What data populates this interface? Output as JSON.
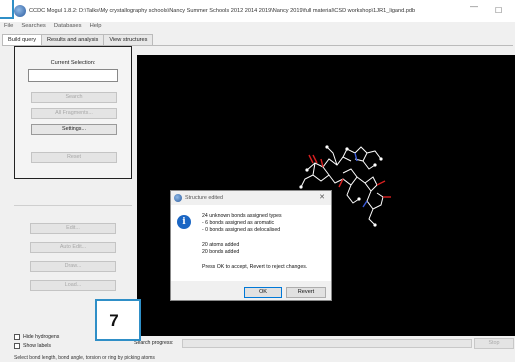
{
  "window": {
    "title": "CCDC Mogul 1.8.2: D:\\Talks\\My crystallography schools\\Nancy Summer Schools 2012 2014 2019\\Nancy 2019\\full material\\CSD workshop\\1JR1_ligand.pdb",
    "minimize": "—",
    "maximize": "☐"
  },
  "menu": [
    "File",
    "Searches",
    "Databases",
    "Help"
  ],
  "tabs": [
    "Build query",
    "Results and analysis",
    "View structures"
  ],
  "left_panel": {
    "current_selection_label": "Current Selection:",
    "search": "Search",
    "all_fragments": "All Fragments...",
    "settings": "Settings...",
    "reset": "Reset"
  },
  "lower_panel": {
    "edit": "Edit...",
    "auto_edit": "Auto Edit...",
    "draw": "Draw...",
    "load": "Load..."
  },
  "checkboxes": {
    "hide_hydrogens": "Hide hydrogens",
    "show_labels": "Show labels"
  },
  "progress": {
    "label": "Search progress:",
    "stop": "Stop"
  },
  "status_bar": "Select bond length, bond angle, torsion or ring by picking atoms",
  "callout": "7",
  "dialog": {
    "title": "Structure edited",
    "close": "✕",
    "lines": [
      "24 unknown bonds assigned types",
      " - 6 bonds assigned as aromatic",
      " - 0 bonds assigned as delocalised",
      "20 atoms added",
      "20 bonds added",
      "Press OK to accept, Revert to reject changes."
    ],
    "ok": "OK",
    "revert": "Revert"
  },
  "colors": {
    "accent": "#2f8fc7",
    "viewer_bg": "#000000",
    "info_icon": "#1a66c4"
  }
}
